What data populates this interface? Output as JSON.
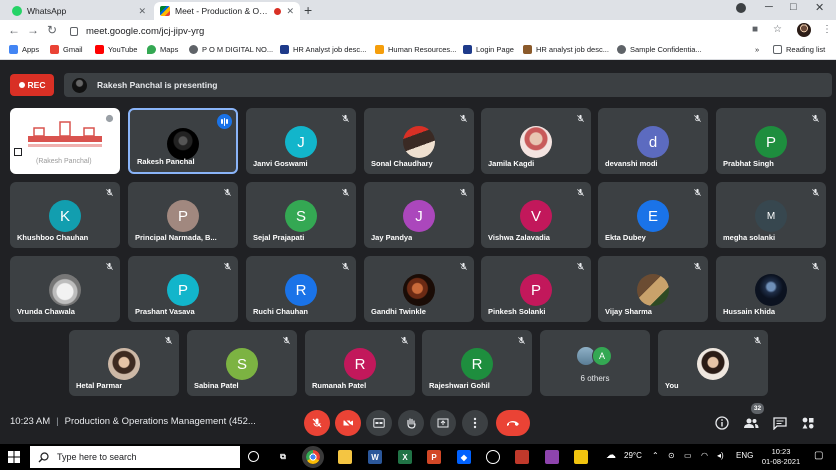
{
  "browser": {
    "tabs": [
      {
        "title": "WhatsApp",
        "active": false,
        "icon": "whatsapp-icon"
      },
      {
        "title": "Meet - Production & Operati",
        "active": true,
        "icon": "meet-icon",
        "recording": true
      }
    ],
    "new_tab": "+",
    "url": "meet.google.com/jcj-jipv-yrg",
    "window_controls": [
      "─",
      "□",
      "✕"
    ]
  },
  "bookmarks": {
    "items": [
      {
        "label": "Apps",
        "icon": "apps-grid-icon",
        "color": "#4285f4"
      },
      {
        "label": "Gmail",
        "icon": "gmail-icon",
        "color": "#ea4335"
      },
      {
        "label": "YouTube",
        "icon": "youtube-icon",
        "color": "#ff0000"
      },
      {
        "label": "Maps",
        "icon": "maps-icon",
        "color": "#34a853"
      },
      {
        "label": "P O M DIGITAL NO...",
        "icon": "globe-icon",
        "color": "#5f6368"
      },
      {
        "label": "HR Analyst job desc...",
        "icon": "hr-icon",
        "color": "#1e3a8a"
      },
      {
        "label": "Human Resources...",
        "icon": "folder-icon",
        "color": "#f59e0b"
      },
      {
        "label": "Login Page",
        "icon": "ir-icon",
        "color": "#1e3a8a"
      },
      {
        "label": "HR analyst job desc...",
        "icon": "hr-grid-icon",
        "color": "#8b5a2b"
      },
      {
        "label": "Sample Confidentia...",
        "icon": "at-icon",
        "color": "#5f6368"
      }
    ],
    "reading_list": "Reading list"
  },
  "meet": {
    "rec_label": "REC",
    "presenting_text": "Rakesh Panchal is presenting",
    "share_caption": "(Rakesh Panchal)",
    "participants": [
      {
        "name": "Rakesh Panchal",
        "type": "photo",
        "active": true
      },
      {
        "name": "Janvi Goswami",
        "type": "letter",
        "letter": "J",
        "color": "#12b5cb"
      },
      {
        "name": "Sonal Chaudhary",
        "type": "photo"
      },
      {
        "name": "Jamila Kagdi",
        "type": "photo"
      },
      {
        "name": "devanshi modi",
        "type": "letter",
        "letter": "d",
        "color": "#5c6bc0"
      },
      {
        "name": "Prabhat Singh",
        "type": "letter",
        "letter": "P",
        "color": "#1e8e3e"
      },
      {
        "name": "Khushboo Chauhan",
        "type": "letter",
        "letter": "K",
        "color": "#129eaf"
      },
      {
        "name": "Principal Narmada, B...",
        "type": "letter",
        "letter": "P",
        "color": "#a1887f"
      },
      {
        "name": "Sejal Prajapati",
        "type": "letter",
        "letter": "S",
        "color": "#34a853"
      },
      {
        "name": "Jay Pandya",
        "type": "letter",
        "letter": "J",
        "color": "#ab47bc"
      },
      {
        "name": "Vishwa Zalavadia",
        "type": "letter",
        "letter": "V",
        "color": "#c2185b"
      },
      {
        "name": "Ekta Dubey",
        "type": "letter",
        "letter": "E",
        "color": "#1a73e8"
      },
      {
        "name": "megha solanki",
        "type": "letter",
        "letter": "M",
        "color": "#37474f"
      },
      {
        "name": "Vrunda Chawala",
        "type": "photo"
      },
      {
        "name": "Prashant Vasava",
        "type": "letter",
        "letter": "P",
        "color": "#12b5cb"
      },
      {
        "name": "Ruchi Chauhan",
        "type": "letter",
        "letter": "R",
        "color": "#1a73e8"
      },
      {
        "name": "Gandhi Twinkle",
        "type": "photo"
      },
      {
        "name": "Pinkesh Solanki",
        "type": "letter",
        "letter": "P",
        "color": "#c2185b"
      },
      {
        "name": "Vijay Sharma",
        "type": "photo"
      },
      {
        "name": "Hussain Khida",
        "type": "photo"
      },
      {
        "name": "Hetal Parmar",
        "type": "photo"
      },
      {
        "name": "Sabina Patel",
        "type": "letter",
        "letter": "S",
        "color": "#7cb342"
      },
      {
        "name": "Rumanah Patel",
        "type": "letter",
        "letter": "R",
        "color": "#c2185b"
      },
      {
        "name": "Rajeshwari Gohil",
        "type": "letter",
        "letter": "R",
        "color": "#1e8e3e"
      },
      {
        "name": "You",
        "type": "photo"
      }
    ],
    "others": {
      "label": "6 others",
      "letter": "A"
    },
    "time": "10:23 AM",
    "meeting_title": "Production & Operations Management (452...",
    "participant_count": "32"
  },
  "taskbar": {
    "search_placeholder": "Type here to search",
    "weather": "29°C",
    "language": "ENG",
    "time": "10:23",
    "date": "01-08-2021"
  }
}
